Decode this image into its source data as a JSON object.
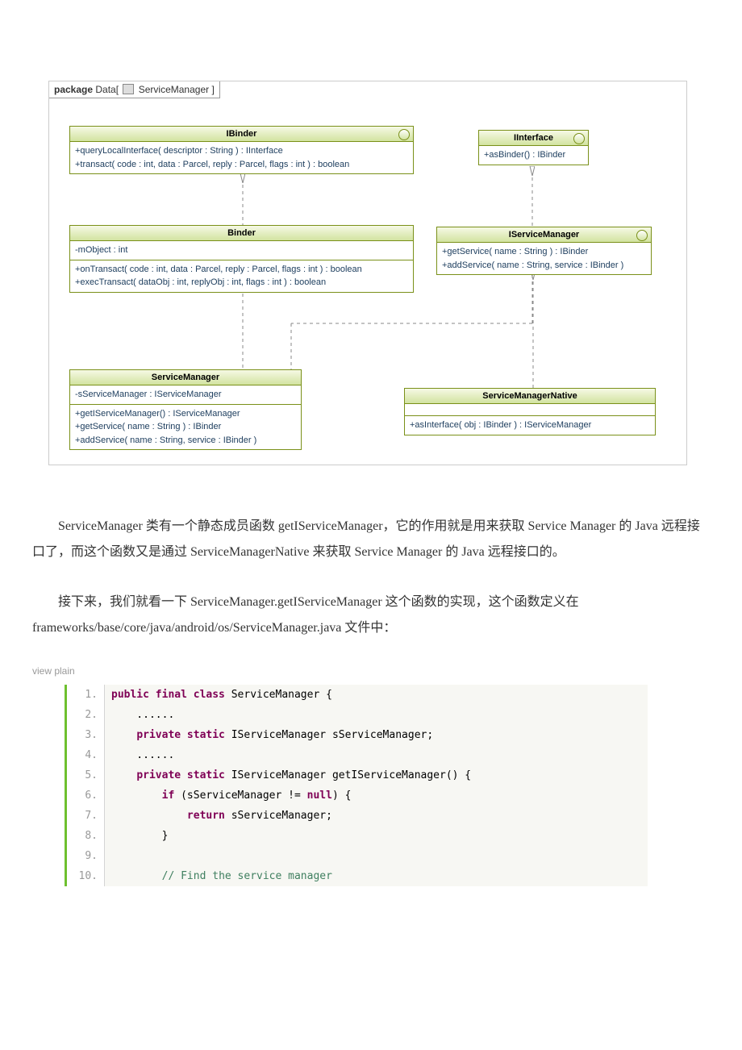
{
  "uml": {
    "package_prefix": "package",
    "package_name": "Data",
    "package_tab": "ServiceManager",
    "ibinder": {
      "name": "IBinder",
      "methods": "+queryLocalInterface( descriptor : String ) : IInterface\n+transact( code : int, data : Parcel, reply : Parcel, flags : int ) : boolean"
    },
    "iinterface": {
      "name": "IInterface",
      "methods": "+asBinder() : IBinder"
    },
    "binder": {
      "name": "Binder",
      "attrs": "-mObject : int",
      "methods": "+onTransact( code : int, data : Parcel, reply : Parcel, flags : int ) : boolean\n+execTransact( dataObj : int, replyObj : int, flags : int ) : boolean"
    },
    "iservicemanager": {
      "name": "IServiceManager",
      "methods": "+getService( name : String ) : IBinder\n+addService( name : String, service : IBinder )"
    },
    "servicemanager": {
      "name": "ServiceManager",
      "attrs": "-sServiceManager : IServiceManager",
      "methods": "+getIServiceManager() : IServiceManager\n+getService( name : String ) : IBinder\n+addService( name : String, service : IBinder )"
    },
    "servicemanagernative": {
      "name": "ServiceManagerNative",
      "methods": "+asInterface( obj : IBinder ) : IServiceManager"
    }
  },
  "paragraph1": "ServiceManager 类有一个静态成员函数 getIServiceManager，它的作用就是用来获取 Service Manager 的 Java 远程接口了，而这个函数又是通过 ServiceManagerNative 来获取 Service Manager 的 Java 远程接口的。",
  "paragraph2": "接下来，我们就看一下 ServiceManager.getIServiceManager 这个函数的实现，这个函数定义在 frameworks/base/core/java/android/os/ServiceManager.java 文件中：",
  "view_plain": "view plain",
  "code": [
    {
      "n": "1.",
      "kw1": "public final class ",
      "t1": "ServiceManager {  "
    },
    {
      "n": "2.",
      "plain": "    ......  "
    },
    {
      "n": "3.",
      "indent": "    ",
      "kw1": "private static ",
      "t1": "IServiceManager sServiceManager;  "
    },
    {
      "n": "4.",
      "plain": "    ......  "
    },
    {
      "n": "5.",
      "indent": "    ",
      "kw1": "private static ",
      "t1": "IServiceManager getIServiceManager() {  "
    },
    {
      "n": "6.",
      "indent": "        ",
      "kw1": "if ",
      "t1": "(sServiceManager != ",
      "kw2": "null",
      "t2": ") {  "
    },
    {
      "n": "7.",
      "indent": "            ",
      "kw1": "return ",
      "t1": "sServiceManager;  "
    },
    {
      "n": "8.",
      "plain": "        }  "
    },
    {
      "n": "9.",
      "plain": "  "
    },
    {
      "n": "10.",
      "indent": "        ",
      "cm": "// Find the service manager  "
    }
  ]
}
